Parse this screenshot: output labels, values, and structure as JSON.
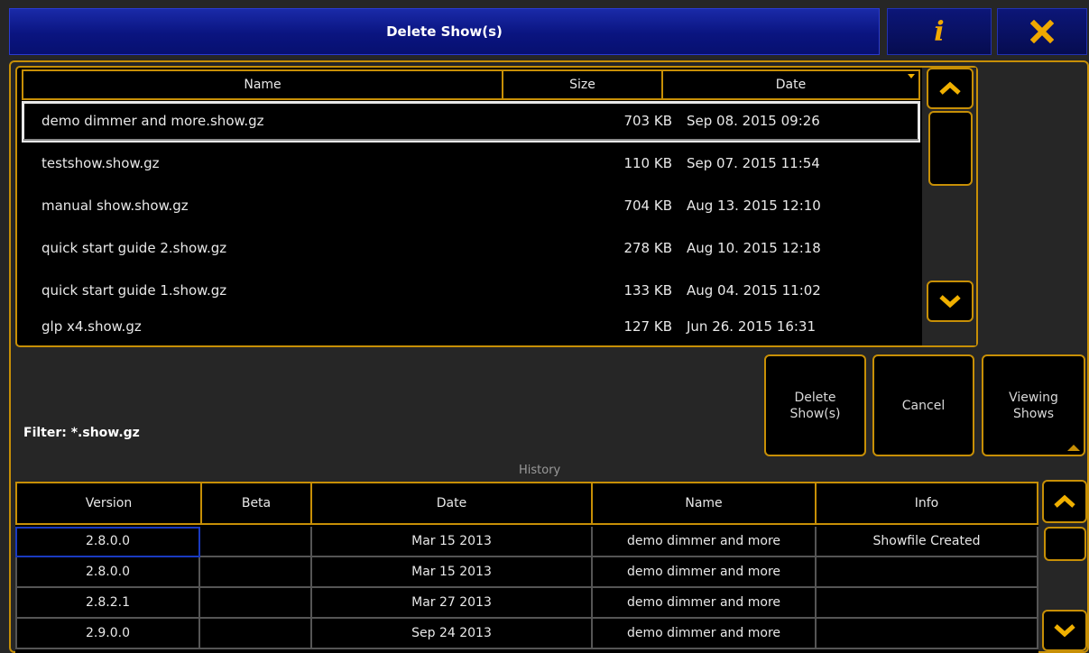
{
  "window": {
    "title": "Delete Show(s)",
    "info_label": "i",
    "info_icon": "info-icon",
    "close_icon": "close-x-icon"
  },
  "file_list": {
    "columns": [
      "Name",
      "Size",
      "Date"
    ],
    "sort_indicator_column": "Date",
    "rows": [
      {
        "name": "demo dimmer and more.show.gz",
        "size": "703 KB",
        "date": "Sep 08. 2015 09:26",
        "selected": true
      },
      {
        "name": "testshow.show.gz",
        "size": "110 KB",
        "date": "Sep 07. 2015 11:54"
      },
      {
        "name": "manual show.show.gz",
        "size": "704 KB",
        "date": "Aug 13. 2015 12:10"
      },
      {
        "name": "quick start guide 2.show.gz",
        "size": "278 KB",
        "date": "Aug 10. 2015 12:18"
      },
      {
        "name": "quick start guide 1.show.gz",
        "size": "133 KB",
        "date": "Aug 04. 2015 11:02"
      },
      {
        "name": "glp x4.show.gz",
        "size": "127 KB",
        "date": "Jun 26. 2015 16:31"
      }
    ]
  },
  "filter": {
    "label": "Filter: *.show.gz"
  },
  "buttons": {
    "delete_line1": "Delete",
    "delete_line2": "Show(s)",
    "cancel": "Cancel",
    "viewing_line1": "Viewing",
    "viewing_line2": "Shows"
  },
  "history": {
    "label": "History",
    "columns": [
      "Version",
      "Beta",
      "Date",
      "Name",
      "Info"
    ],
    "rows": [
      {
        "version": "2.8.0.0",
        "beta": "",
        "date": "Mar 15 2013",
        "name": "demo dimmer and more",
        "info": "Showfile Created"
      },
      {
        "version": "2.8.0.0",
        "beta": "",
        "date": "Mar 15 2013",
        "name": "demo dimmer and more",
        "info": ""
      },
      {
        "version": "2.8.2.1",
        "beta": "",
        "date": "Mar 27 2013",
        "name": "demo dimmer and more",
        "info": ""
      },
      {
        "version": "2.9.0.0",
        "beta": "",
        "date": "Sep 24 2013",
        "name": "demo dimmer and more",
        "info": ""
      }
    ]
  },
  "colors": {
    "accent": "#c78f06",
    "title_blue": "#0a1480",
    "info_icon": "#f0a800"
  }
}
